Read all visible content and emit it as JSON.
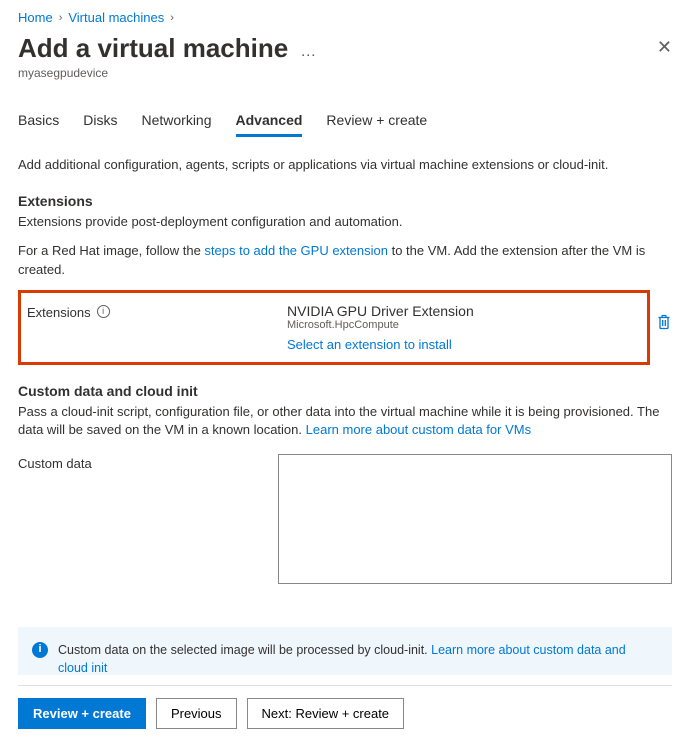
{
  "breadcrumb": {
    "items": [
      "Home",
      "Virtual machines"
    ]
  },
  "header": {
    "title": "Add a virtual machine",
    "subtitle": "myasegpudevice"
  },
  "tabs": [
    {
      "label": "Basics"
    },
    {
      "label": "Disks"
    },
    {
      "label": "Networking"
    },
    {
      "label": "Advanced"
    },
    {
      "label": "Review + create"
    }
  ],
  "advanced": {
    "intro": "Add additional configuration, agents, scripts or applications via virtual machine extensions or cloud-init.",
    "extensions": {
      "heading": "Extensions",
      "desc": "Extensions provide post-deployment configuration and automation.",
      "redhat_pre": "For a Red Hat image, follow the ",
      "redhat_link": "steps to add the GPU extension",
      "redhat_post": " to the VM. Add the extension after the VM is created.",
      "field_label": "Extensions",
      "item": {
        "name": "NVIDIA GPU Driver Extension",
        "publisher": "Microsoft.HpcCompute"
      },
      "select_link": "Select an extension to install"
    },
    "custom": {
      "heading": "Custom data and cloud init",
      "desc_pre": "Pass a cloud-init script, configuration file, or other data into the virtual machine while it is being provisioned. The data will be saved on the VM in a known location. ",
      "desc_link": "Learn more about custom data for VMs",
      "field_label": "Custom data",
      "value": ""
    },
    "infobar": {
      "text_pre": "Custom data on the selected image will be processed by cloud-init. ",
      "text_link": "Learn more about custom data and cloud init"
    }
  },
  "footer": {
    "review": "Review + create",
    "previous": "Previous",
    "next": "Next: Review + create"
  }
}
